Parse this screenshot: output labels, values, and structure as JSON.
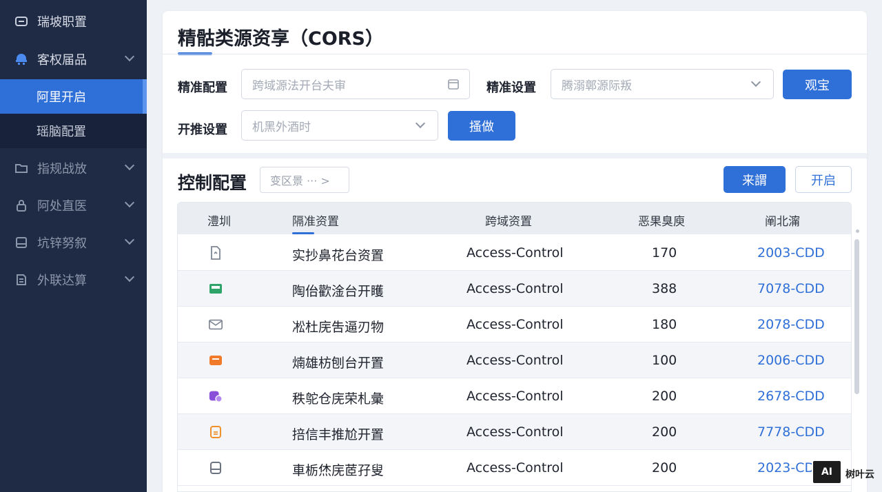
{
  "sidebar": {
    "items": [
      {
        "label": "瑞坡职置",
        "icon": "settings-icon"
      },
      {
        "label": "客权届品",
        "icon": "service-icon"
      },
      {
        "label": "阿里开启",
        "icon": ""
      },
      {
        "label": "瑶脑配置",
        "icon": ""
      },
      {
        "label": "指规战放",
        "icon": "folder-icon"
      },
      {
        "label": "阿处直医",
        "icon": "lock-icon"
      },
      {
        "label": "坑锌努叙",
        "icon": "document-icon"
      },
      {
        "label": "外联达算",
        "icon": "billing-icon"
      }
    ]
  },
  "header": {
    "title": "精骷类源资享（CORS）"
  },
  "filters": {
    "row1_label": "精准配置",
    "row1_placeholder": "跨域源法开台夫审",
    "row1_right_label": "精准设置",
    "row1_right_placeholder": "腾溺鄣源际叛",
    "confirm_button": "观宝",
    "row2_label": "开推设置",
    "row2_placeholder": "机黑外酒时",
    "search_button": "搔做"
  },
  "section": {
    "title": "控制配置",
    "breadcrumb": "变区景 ··· >",
    "primary_button": "来謂",
    "secondary_button": "开启"
  },
  "table": {
    "headers": [
      "澧圳",
      "隔准资置",
      "跨域资置",
      "恶果臭庾",
      "阐北澝"
    ],
    "rows": [
      {
        "icon": "file-icon",
        "icon_color": "#7d8593",
        "name": "实抄鼻花台资置",
        "access": "Access-Control",
        "count": "170",
        "code": "2003-CDD"
      },
      {
        "icon": "image-icon",
        "icon_color": "#2fa46a",
        "name": "陶佁歡淦台开矆",
        "access": "Access-Control",
        "count": "388",
        "code": "7078-CDD"
      },
      {
        "icon": "mail-icon",
        "icon_color": "#7d8593",
        "name": "凇杜庑吿逼刃物",
        "access": "Access-Control",
        "count": "180",
        "code": "2078-CDD"
      },
      {
        "icon": "inbox-icon",
        "icon_color": "#f07a2a",
        "name": "煵雄枋刨台开置",
        "access": "Access-Control",
        "count": "100",
        "code": "2006-CDD"
      },
      {
        "icon": "tag-icon",
        "icon_color": "#8a4fd9",
        "name": "秩鸵仓庑荣札彙",
        "access": "Access-Control",
        "count": "200",
        "code": "2678-CDD"
      },
      {
        "icon": "badge-icon",
        "icon_color": "#f0902a",
        "name": "掊信丰推尬开置",
        "access": "Access-Control",
        "count": "200",
        "code": "7778-CDD"
      },
      {
        "icon": "card-icon",
        "icon_color": "#6b7280",
        "name": "車栃烋庑茝孖叟",
        "access": "Access-Control",
        "count": "200",
        "code": "2023-CDD"
      }
    ]
  },
  "watermark": {
    "box": "AI",
    "text": "树叶云"
  }
}
